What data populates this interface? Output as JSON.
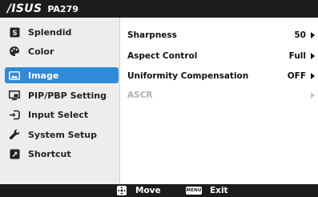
{
  "titlebar": {
    "brand": "/ISUS",
    "model": "PA279"
  },
  "sidebar": {
    "items": [
      {
        "label": "Splendid",
        "icon": "splendid-icon"
      },
      {
        "label": "Color",
        "icon": "palette-icon"
      },
      {
        "label": "Image",
        "icon": "image-icon",
        "selected": true
      },
      {
        "label": "PIP/PBP Setting",
        "icon": "pip-icon"
      },
      {
        "label": "Input Select",
        "icon": "input-select-icon"
      },
      {
        "label": "System Setup",
        "icon": "wrench-icon"
      },
      {
        "label": "Shortcut",
        "icon": "shortcut-icon"
      }
    ]
  },
  "content": {
    "rows": [
      {
        "label": "Sharpness",
        "value": "50",
        "enabled": true
      },
      {
        "label": "Aspect Control",
        "value": "Full",
        "enabled": true
      },
      {
        "label": "Uniformity Compensation",
        "value": "OFF",
        "enabled": true
      },
      {
        "label": "ASCR",
        "value": "",
        "enabled": false
      }
    ]
  },
  "bottombar": {
    "move_label": "Move",
    "menu_key_label": "MENU",
    "exit_label": "Exit"
  },
  "colors": {
    "selection": "#2f8ad8",
    "bar": "#1c1c1c",
    "sidebar_bg": "#ededed"
  }
}
